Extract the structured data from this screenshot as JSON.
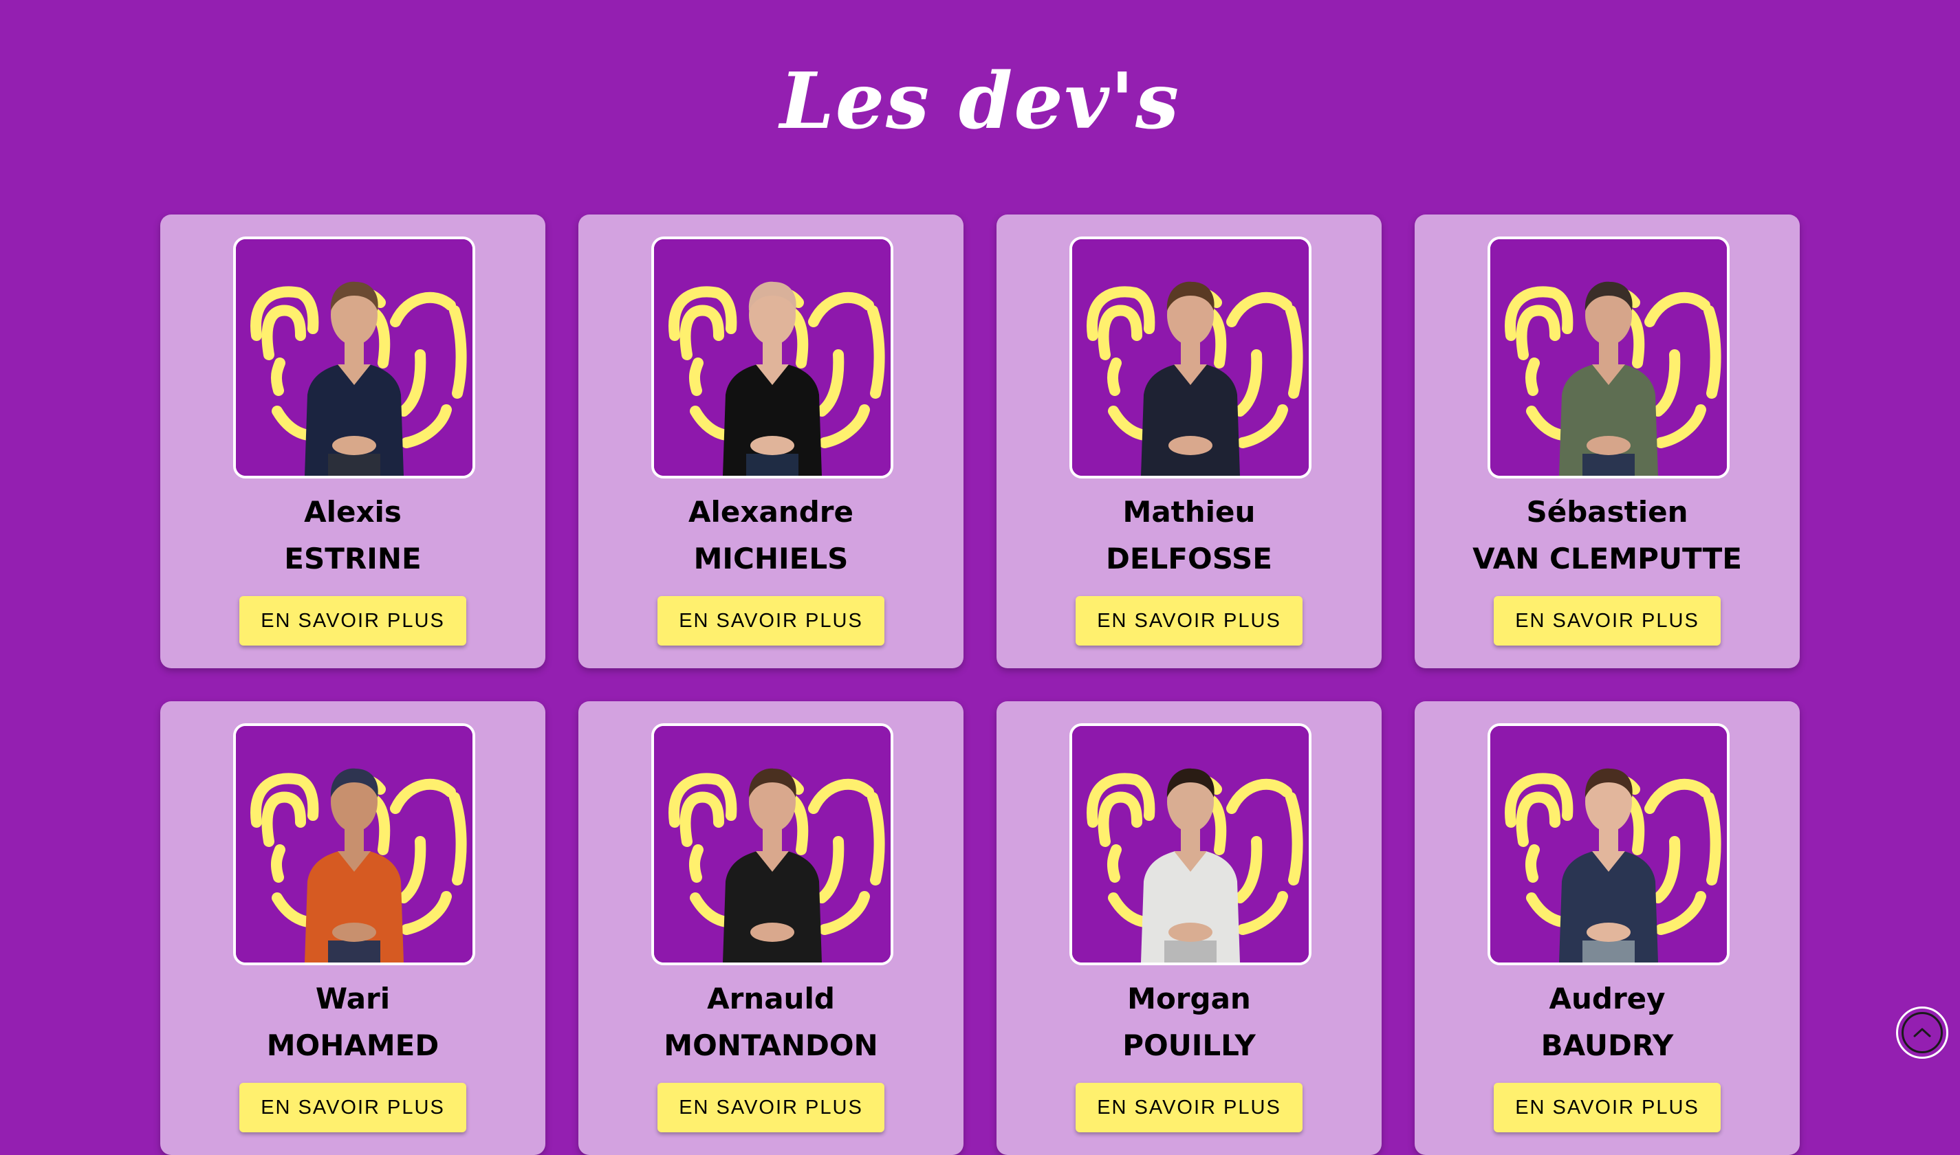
{
  "page": {
    "title": "Les dev's",
    "background_color": "#941fb1",
    "card_color": "#d3a2e0",
    "button_color": "#fff06e",
    "photo_background": "#8e18ac",
    "fingerprint_color": "#fff06e"
  },
  "developers": [
    {
      "first_name": "Alexis",
      "last_name": "ESTRINE",
      "button_label": "EN SAVOIR PLUS",
      "photo": "person-photo",
      "shirt_color": "#1b2440",
      "skin_color": "#d8a88a",
      "hair_color": "#6b4a32",
      "pants_color": "#2b2f3a"
    },
    {
      "first_name": "Alexandre",
      "last_name": "MICHIELS",
      "button_label": "EN SAVOIR PLUS",
      "photo": "person-photo",
      "shirt_color": "#111111",
      "skin_color": "#e0b49a",
      "hair_color": "#d9b19a",
      "pants_color": "#1f2c44"
    },
    {
      "first_name": "Mathieu",
      "last_name": "DELFOSSE",
      "button_label": "EN SAVOIR PLUS",
      "photo": "person-photo",
      "shirt_color": "#1e2233",
      "skin_color": "#d9a88d",
      "hair_color": "#5a3a24",
      "pants_color": "#1e2233"
    },
    {
      "first_name": "Sébastien",
      "last_name": "VAN CLEMPUTTE",
      "button_label": "EN SAVOIR PLUS",
      "photo": "person-photo",
      "shirt_color": "#5e6e52",
      "skin_color": "#d6a58a",
      "hair_color": "#3a2e28",
      "pants_color": "#2a3550"
    },
    {
      "first_name": "Wari",
      "last_name": "MOHAMED",
      "button_label": "EN SAVOIR PLUS",
      "photo": "person-photo",
      "shirt_color": "#d65a22",
      "skin_color": "#c8906e",
      "hair_color": "#2e3450",
      "pants_color": "#2e3450"
    },
    {
      "first_name": "Arnauld",
      "last_name": "MONTANDON",
      "button_label": "EN SAVOIR PLUS",
      "photo": "person-photo",
      "shirt_color": "#1a1a1a",
      "skin_color": "#d9a88d",
      "hair_color": "#4a3020",
      "pants_color": "#1a1a1a"
    },
    {
      "first_name": "Morgan",
      "last_name": "POUILLY",
      "button_label": "EN SAVOIR PLUS",
      "photo": "person-photo",
      "shirt_color": "#e4e4e2",
      "skin_color": "#d9ad92",
      "hair_color": "#2a1c14",
      "pants_color": "#b8b8b8"
    },
    {
      "first_name": "Audrey",
      "last_name": "BAUDRY",
      "button_label": "EN SAVOIR PLUS",
      "photo": "person-photo",
      "shirt_color": "#2a3552",
      "skin_color": "#e2b69c",
      "hair_color": "#4a2e20",
      "pants_color": "#7d8a96"
    }
  ],
  "scroll_top": {
    "icon": "chevron-up-icon"
  }
}
